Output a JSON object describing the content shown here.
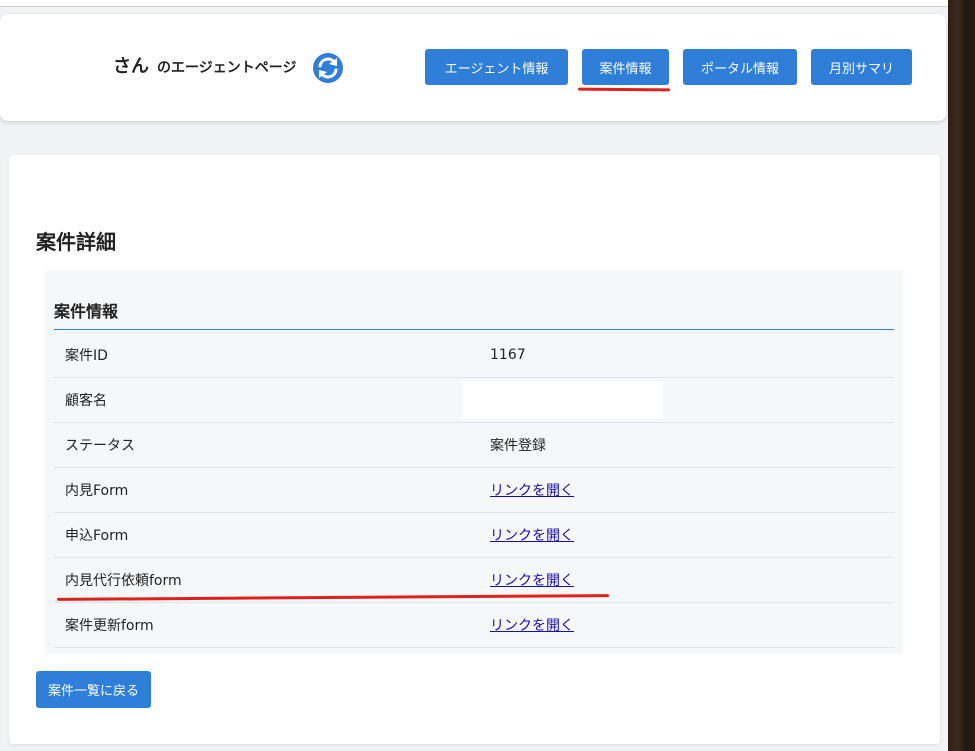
{
  "header": {
    "agent_name": "さん",
    "agent_suffix": "のエージェントページ",
    "refresh_icon": "refresh-icon",
    "nav": {
      "agent_info": "エージェント情報",
      "case_info": "案件情報",
      "portal_info": "ポータル情報",
      "monthly_summary": "月別サマリ"
    }
  },
  "main": {
    "title": "案件詳細",
    "panel_heading": "案件情報",
    "rows": [
      {
        "label": "案件ID",
        "value": "1167"
      },
      {
        "label": "顧客名",
        "value": ""
      },
      {
        "label": "ステータス",
        "value": "案件登録"
      },
      {
        "label": "内見Form",
        "value": "リンクを開く"
      },
      {
        "label": "申込Form",
        "value": "リンクを開く"
      },
      {
        "label": "内見代行依頼form",
        "value": "リンクを開く"
      },
      {
        "label": "案件更新form",
        "value": "リンクを開く"
      }
    ],
    "back_button": "案件一覧に戻る"
  },
  "colors": {
    "accent": "#2f7fd8",
    "highlight_mark": "#e0211b",
    "link": "#1a0dab"
  }
}
